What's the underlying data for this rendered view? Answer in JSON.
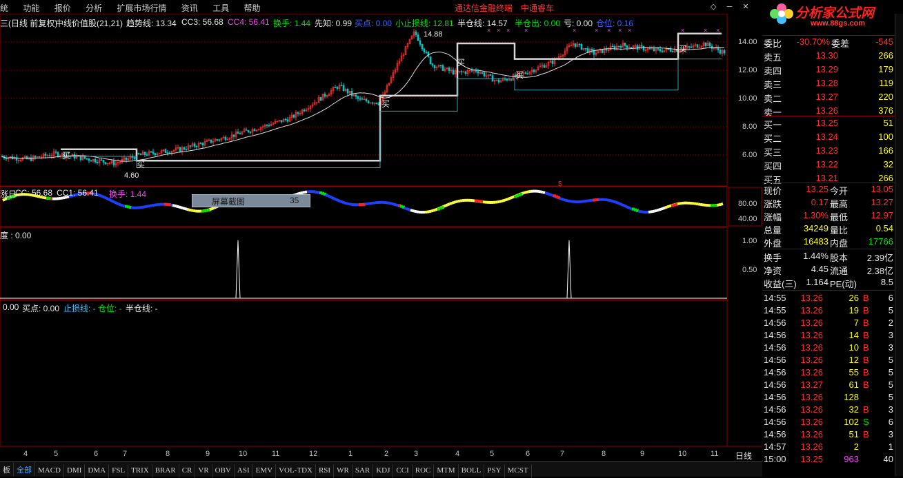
{
  "menu": {
    "items": [
      "统",
      "功能",
      "报价",
      "分析",
      "扩展市场行情",
      "资讯",
      "工具",
      "帮助"
    ],
    "highlight_1": "通达信金融终端",
    "highlight_2": "中通睿车",
    "controls": "◇ ─ ✕"
  },
  "watermark": {
    "brand": "分析家公式网",
    "url": "www.88gs.com"
  },
  "main_header": {
    "period": "三(日线 前复权)",
    "indicator": "中线价值股(21,21)",
    "trend_label": "趋势线: 13.34",
    "cc3": "CC3: 56.68",
    "cc4": "CC4: 56.41",
    "turnover": "换手: 1.44",
    "xianzhi": "先知: 0.99",
    "buypoint": "买点: 0.00",
    "small_stop": "小止损线: 12.81",
    "half_pos": "半仓线: 14.57",
    "half_out": "半仓出: 0.00",
    "loss": "亏: 0.00",
    "position": "仓位: 0.16"
  },
  "price_axis": [
    "14.00",
    "12.00",
    "10.00",
    "8.00",
    "6.00"
  ],
  "price_annotations": {
    "high": "14.88",
    "low": "4.60",
    "buy": "买"
  },
  "indicator_header": {
    "name": "涨日",
    "cc": "CC: 56.68",
    "cc1": "CC1: 56.41",
    "turnover": "换手: 1.44"
  },
  "popup": {
    "label": "屏幕截图",
    "value": "35"
  },
  "indicator_axis": [
    "80.00",
    "40.00"
  ],
  "signal_header": "度 : 0.00",
  "signal_axis": [
    "1.00",
    "0.50"
  ],
  "bottom_header": {
    "val": "0.00",
    "buy": "买点: 0.00",
    "stop": "止损线: -",
    "pos": "仓位: -",
    "half": "半仓线: -"
  },
  "x_axis": {
    "labels": [
      "4",
      "5",
      "6",
      "7",
      "8",
      "9",
      "10",
      "11",
      "12",
      "1",
      "2",
      "3",
      "4",
      "5",
      "6",
      "7",
      "8",
      "9",
      "10",
      "11"
    ],
    "period": "日线"
  },
  "tabs": [
    "板",
    "全部",
    "MACD",
    "DMI",
    "DMA",
    "FSL",
    "TRIX",
    "BRAR",
    "CR",
    "VR",
    "OBV",
    "ASI",
    "EMV",
    "VOL-TDX",
    "RSI",
    "WR",
    "SAR",
    "KDJ",
    "CCI",
    "ROC",
    "MTM",
    "BOLL",
    "PSY",
    "MCST"
  ],
  "active_tab": "全部",
  "quote": {
    "code_row": {
      "label": "委比",
      "pct": "-30.70%",
      "label2": "委差",
      "val": "-545"
    },
    "asks": [
      {
        "label": "卖五",
        "price": "13.30",
        "vol": "266"
      },
      {
        "label": "卖四",
        "price": "13.29",
        "vol": "179"
      },
      {
        "label": "卖三",
        "price": "13.28",
        "vol": "119"
      },
      {
        "label": "卖二",
        "price": "13.27",
        "vol": "220"
      },
      {
        "label": "卖一",
        "price": "13.26",
        "vol": "376"
      }
    ],
    "bids": [
      {
        "label": "买一",
        "price": "13.25",
        "vol": "51"
      },
      {
        "label": "买二",
        "price": "13.24",
        "vol": "100"
      },
      {
        "label": "买三",
        "price": "13.23",
        "vol": "166"
      },
      {
        "label": "买四",
        "price": "13.22",
        "vol": "32"
      },
      {
        "label": "买五",
        "price": "13.21",
        "vol": "266"
      }
    ],
    "stats": [
      {
        "l1": "现价",
        "v1": "13.25",
        "l2": "今开",
        "v2": "13.05"
      },
      {
        "l1": "涨跌",
        "v1": "0.17",
        "l2": "最高",
        "v2": "13.27"
      },
      {
        "l1": "涨幅",
        "v1": "1.30%",
        "l2": "最低",
        "v2": "12.97"
      },
      {
        "l1": "总量",
        "v1": "34249",
        "l2": "量比",
        "v2": "0.54"
      },
      {
        "l1": "外盘",
        "v1": "16483",
        "l2": "内盘",
        "v2": "17766"
      }
    ],
    "fundamentals": [
      {
        "l1": "换手",
        "v1": "1.44%",
        "l2": "股本",
        "v2": "2.39亿"
      },
      {
        "l1": "净资",
        "v1": "4.45",
        "l2": "流通",
        "v2": "2.38亿"
      },
      {
        "l1": "收益(三)",
        "v1": "1.164",
        "l2": "PE(动)",
        "v2": "8.5"
      }
    ],
    "ticks": [
      {
        "time": "14:55",
        "price": "13.26",
        "vol": "26",
        "side": "B",
        "n": "6"
      },
      {
        "time": "14:55",
        "price": "13.26",
        "vol": "19",
        "side": "B",
        "n": "5"
      },
      {
        "time": "14:56",
        "price": "13.26",
        "vol": "7",
        "side": "B",
        "n": "2"
      },
      {
        "time": "14:56",
        "price": "13.26",
        "vol": "14",
        "side": "B",
        "n": "3"
      },
      {
        "time": "14:56",
        "price": "13.26",
        "vol": "10",
        "side": "B",
        "n": "3"
      },
      {
        "time": "14:56",
        "price": "13.26",
        "vol": "12",
        "side": "B",
        "n": "5"
      },
      {
        "time": "14:56",
        "price": "13.26",
        "vol": "55",
        "side": "B",
        "n": "5"
      },
      {
        "time": "14:56",
        "price": "13.27",
        "vol": "61",
        "side": "B",
        "n": "5"
      },
      {
        "time": "14:56",
        "price": "13.26",
        "vol": "128",
        "side": "",
        "n": "5"
      },
      {
        "time": "14:56",
        "price": "13.26",
        "vol": "32",
        "side": "B",
        "n": "3"
      },
      {
        "time": "14:56",
        "price": "13.26",
        "vol": "102",
        "side": "S",
        "n": "6"
      },
      {
        "time": "14:56",
        "price": "13.26",
        "vol": "51",
        "side": "B",
        "n": "3"
      },
      {
        "time": "14:57",
        "price": "13.26",
        "vol": "2",
        "side": "",
        "n": "1"
      },
      {
        "time": "15:00",
        "price": "13.25",
        "vol": "963",
        "side": "",
        "n": "40"
      }
    ]
  },
  "colors": {
    "up": "#ff3030",
    "down": "#00e000",
    "grid": "#8b0000",
    "ma": "#e0e0e0",
    "step": "#d8d8d8",
    "stop": "#40a0b0"
  }
}
